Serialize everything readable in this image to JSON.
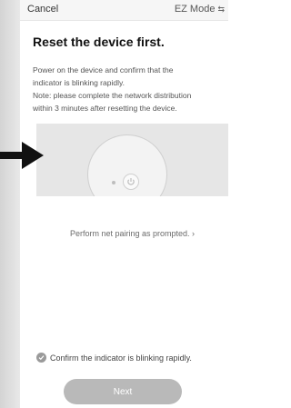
{
  "topbar": {
    "cancel_label": "Cancel",
    "mode_label": "EZ Mode",
    "mode_icon": "switch-icon"
  },
  "main": {
    "title": "Reset the device first.",
    "desc_line1": "Power on the device and confirm that the",
    "desc_line2": "indicator is blinking rapidly.",
    "desc_line3": "Note: please complete the network distribution",
    "desc_line4": "within 3 minutes after resetting the device.",
    "pairing_link": "Perform net pairing as prompted. ›",
    "confirm_text": "Confirm the indicator is blinking rapidly.",
    "next_label": "Next"
  },
  "colors": {
    "disabled_button": "#b9b9b9",
    "illustration_bg": "#e6e6e6"
  }
}
